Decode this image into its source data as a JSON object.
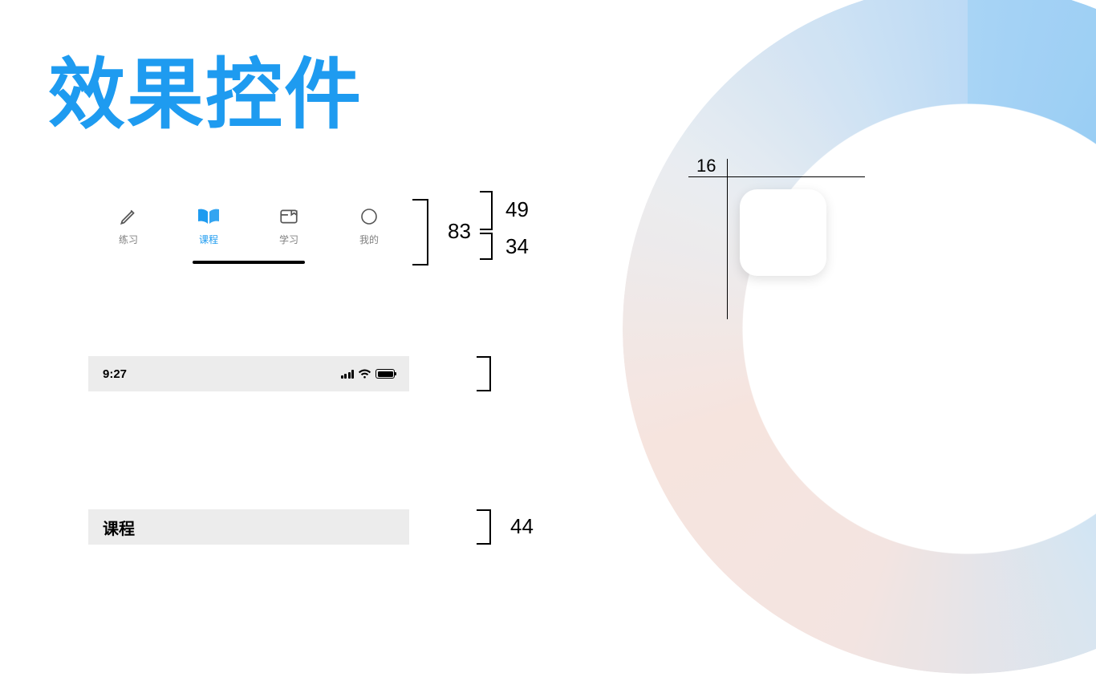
{
  "title": "效果控件",
  "tabbar": {
    "height_total": 83,
    "height_icon_row": 49,
    "height_indicator_row": 34,
    "items": [
      {
        "label": "练习",
        "icon": "pencil-icon",
        "active": false
      },
      {
        "label": "课程",
        "icon": "book-icon",
        "active": true
      },
      {
        "label": "学习",
        "icon": "learn-icon",
        "active": false
      },
      {
        "label": "我的",
        "icon": "profile-icon",
        "active": false
      }
    ]
  },
  "statusbar": {
    "time": "9:27",
    "height": 44
  },
  "navbar": {
    "title": "课程",
    "height": 44
  },
  "tile": {
    "corner_radius": 16
  },
  "dims": {
    "d83": "83",
    "d49": "49",
    "d34": "34",
    "d44": "44",
    "d16": "16"
  }
}
